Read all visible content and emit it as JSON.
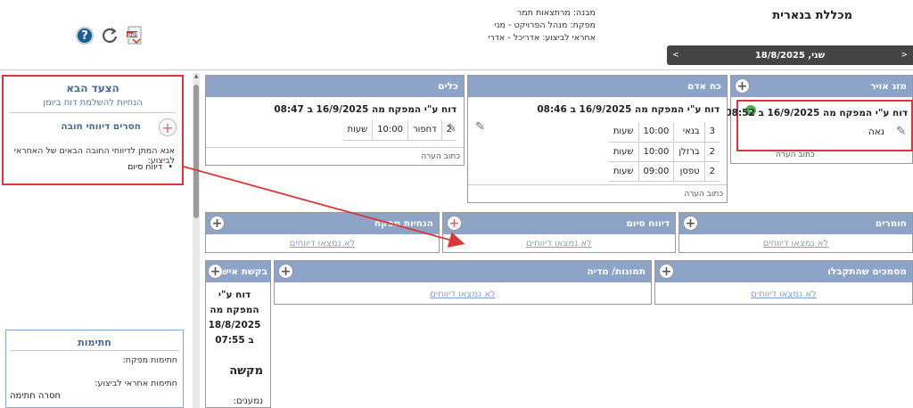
{
  "header": {
    "project_title": "מכללת בנארית",
    "building": "מבנה: מרתצאות תמר",
    "supervisor": "מפקח: מנהל הפרויקט - מני",
    "executor": "אחראי לביצוע: אדריכל - אדרי",
    "icons": [
      "help-icon",
      "refresh-icon",
      "pdf-icon"
    ]
  },
  "date_bar": {
    "prev": "<",
    "date": "שני, 18/8/2025",
    "next": ">"
  },
  "next_step": {
    "title": "הצעד הבא",
    "subtitle": "הנחיות להשלמת דוח ביומן",
    "missing_title": "חסרים דיווחי חובה",
    "missing_desc": "אנא המתן לדיווחי החובה הבאים של האחראי לביצוע:",
    "missing_items": [
      "דיווח סיום"
    ]
  },
  "signatures": {
    "title": "חתימות",
    "supervisor_label": "חתימות מפקח:",
    "executor_label": "חתימות אחראי לביצוע:",
    "missing": "חסרה חתימה"
  },
  "panels": {
    "weather": {
      "title": "מזג אויר",
      "report": "דוח ע\"י המפקח מה 16/9/2025 ב 08:52",
      "value": "נאה",
      "note": "כתוב הערה"
    },
    "manpower": {
      "title": "כח אדם",
      "report": "דוח ע\"י המפקח מה 16/9/2025 ב 08:46",
      "rows": [
        {
          "count": "3",
          "role": "בנאי",
          "time": "10:00",
          "unit": "שעות"
        },
        {
          "count": "2",
          "role": "ברזלן",
          "time": "10:00",
          "unit": "שעות"
        },
        {
          "count": "2",
          "role": "טפסן",
          "time": "09:00",
          "unit": "שעות"
        }
      ],
      "note": "כתוב הערה"
    },
    "tools": {
      "title": "כלים",
      "report": "דוח ע\"י המפקח מה 16/9/2025 ב 08:47",
      "rows": [
        {
          "count": "2",
          "role": "דחפור",
          "time": "10:00",
          "unit": "שעות"
        }
      ],
      "note": "כתוב הערה"
    },
    "materials": {
      "title": "חומרים",
      "empty": "לא נמצאו דיווחים"
    },
    "finish_report": {
      "title": "דיווח סיום",
      "empty": "לא נמצאו דיווחים"
    },
    "supervisor_instructions": {
      "title": "הנחיות מפקח",
      "empty": "לא נמצאו דיווחים"
    },
    "documents": {
      "title": "מסמכים שהתקבלו",
      "empty": "לא נמצאו דיווחים"
    },
    "media": {
      "title": "תמונות/ מדיה",
      "empty": "לא נמצאו דיווחים"
    },
    "approval": {
      "title": "בקשת אישור",
      "report": "דוח ע\"י המפקח מה 18/8/2025 ב 07:55",
      "status": "מקשה",
      "interested": "נמענים:"
    }
  },
  "colors": {
    "panel_header": "#8ea4c6",
    "highlight": "#d9383a",
    "date_bar": "#444444"
  }
}
